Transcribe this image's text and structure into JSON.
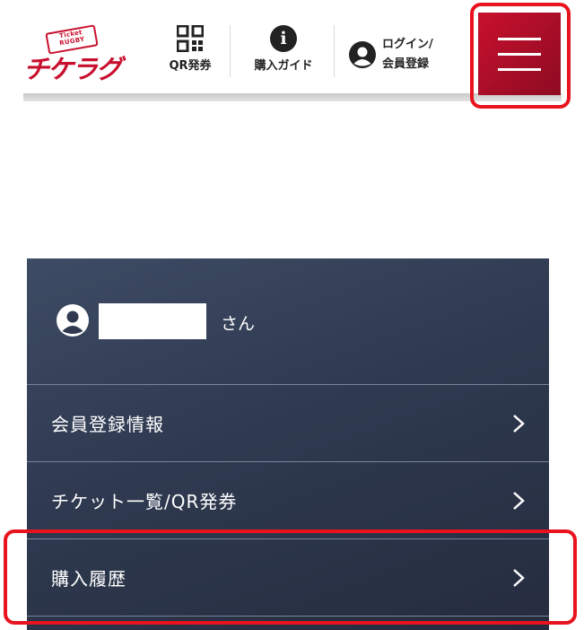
{
  "header": {
    "logo": {
      "badge_line1": "Ticket",
      "badge_line2": "RUGBY",
      "text": "チケラグ"
    },
    "qr_label": "QR発券",
    "guide_label": "購入ガイド",
    "login_line1": "ログイン/",
    "login_line2": "会員登録",
    "icons": {
      "qr": "qr-code-icon",
      "guide": "info-icon",
      "login": "user-icon",
      "menu": "hamburger-menu-icon"
    }
  },
  "drawer": {
    "user": {
      "name": "",
      "suffix": "さん"
    },
    "items": [
      {
        "label": "会員登録情報",
        "icon": "chevron-right-icon"
      },
      {
        "label": "チケット一覧/QR発券",
        "icon": "chevron-right-icon"
      },
      {
        "label": "購入履歴",
        "icon": "chevron-right-icon"
      }
    ]
  },
  "colors": {
    "brand_red": "#c8102e",
    "drawer_bg": "#2f3a50",
    "annotation_red": "#e8131e"
  }
}
